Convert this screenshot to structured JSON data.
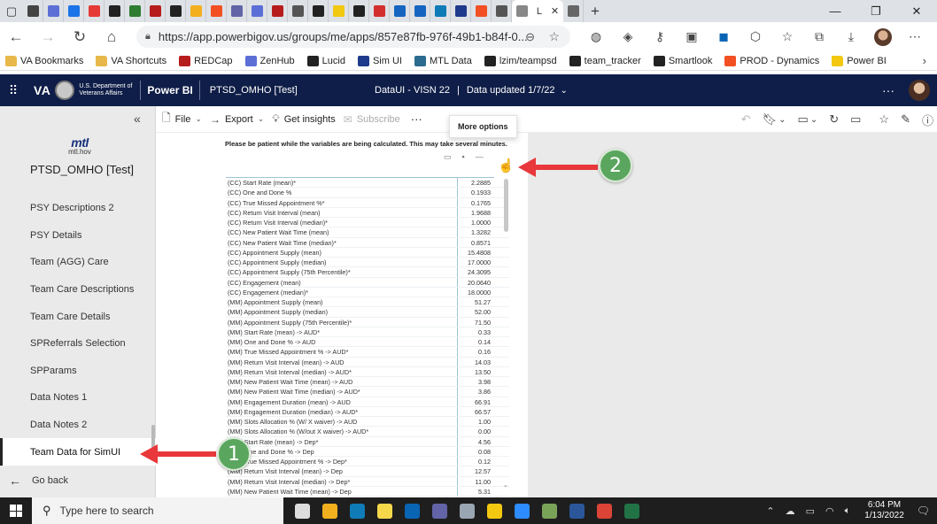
{
  "browser": {
    "tabs": [
      {
        "icon": "window-icon",
        "color": "#444444"
      },
      {
        "icon": "zenhub-icon",
        "color": "#5b6fd6"
      },
      {
        "icon": "bing-icon",
        "color": "#1a73e8"
      },
      {
        "icon": "asterisk-icon",
        "color": "#e53935"
      },
      {
        "icon": "github-icon",
        "color": "#222222"
      },
      {
        "icon": "sheet-icon",
        "color": "#2e7d32"
      },
      {
        "icon": "redcap-icon",
        "color": "#b71c1c"
      },
      {
        "icon": "github-icon",
        "color": "#222222"
      },
      {
        "icon": "doc-icon",
        "color": "#f2b01e"
      },
      {
        "icon": "grid-icon",
        "color": "#f25022"
      },
      {
        "icon": "teams-icon",
        "color": "#6264a7"
      },
      {
        "icon": "zenhub-icon",
        "color": "#5b6fd6"
      },
      {
        "icon": "redcap-icon",
        "color": "#b71c1c"
      },
      {
        "icon": "page-icon",
        "color": "#555555"
      },
      {
        "icon": "github-icon",
        "color": "#222222"
      },
      {
        "icon": "powerbi-icon",
        "color": "#f2c811"
      },
      {
        "icon": "github-icon",
        "color": "#222222"
      },
      {
        "icon": "github-error-icon",
        "color": "#d32f2f"
      },
      {
        "icon": "circle-icon",
        "color": "#1565c0"
      },
      {
        "icon": "circle-icon",
        "color": "#1565c0"
      },
      {
        "icon": "edge-icon",
        "color": "#0f7bb7"
      },
      {
        "icon": "mtl-icon",
        "color": "#1e3a8a"
      },
      {
        "icon": "ms-icon",
        "color": "#f25022"
      },
      {
        "icon": "page-icon",
        "color": "#555555"
      }
    ],
    "active_tab_label": "L",
    "new_tab": "+",
    "url": "https://app.powerbigov.us/groups/me/apps/857e87fb-976f-49b1-b84f-0...",
    "bookmarks": [
      {
        "label": "VA Bookmarks",
        "type": "folder",
        "color": "#e8b84a"
      },
      {
        "label": "VA Shortcuts",
        "type": "folder",
        "color": "#e8b84a"
      },
      {
        "label": "REDCap",
        "type": "icon",
        "color": "#b71c1c"
      },
      {
        "label": "ZenHub",
        "type": "icon",
        "color": "#5b6fd6"
      },
      {
        "label": "Lucid",
        "type": "icon",
        "color": "#222222"
      },
      {
        "label": "Sim UI",
        "type": "icon",
        "color": "#1e3a8a"
      },
      {
        "label": "MTL Data",
        "type": "icon",
        "color": "#2a6b8f"
      },
      {
        "label": "lzim/teampsd",
        "type": "icon",
        "color": "#222222"
      },
      {
        "label": "team_tracker",
        "type": "icon",
        "color": "#222222"
      },
      {
        "label": "Smartlook",
        "type": "icon",
        "color": "#222222"
      },
      {
        "label": "PROD - Dynamics",
        "type": "icon",
        "color": "#f25022"
      },
      {
        "label": "Power BI",
        "type": "folder",
        "color": "#f2c811"
      }
    ]
  },
  "pbi": {
    "org": "VA",
    "dept": "U.S. Department of Veterans Affairs",
    "brand": "Power BI",
    "report": "PTSD_OMHO [Test]",
    "workspace": "DataUI - VISN 22",
    "updated": "Data updated 1/7/22",
    "more": "···"
  },
  "nav": {
    "logo_big": "mtl",
    "logo_small": "mtl.hov",
    "title": "PTSD_OMHO [Test]",
    "items": [
      "PSY Descriptions 2",
      "PSY Details",
      "Team (AGG) Care",
      "Team Care Descriptions",
      "Team Care Details",
      "SPReferrals Selection",
      "SPParams",
      "Data Notes 1",
      "Data Notes 2",
      "Team Data for SimUI"
    ],
    "selected_index": 9,
    "go_back": "Go back"
  },
  "report_toolbar": {
    "file": "File",
    "export": "Export",
    "insights": "Get insights",
    "subscribe": "Subscribe",
    "more": "···",
    "tooltip": "More options"
  },
  "canvas": {
    "notice": "Please be patient while the variables are being calculated.  This may take several minutes.",
    "rows": [
      [
        "(CC) Start Rate (mean)*",
        "2.2885"
      ],
      [
        "(CC) One and Done %",
        "0.1933"
      ],
      [
        "(CC) True Missed Appointment %*",
        "0.1765"
      ],
      [
        "(CC) Return Visit Interval (mean)",
        "1.9688"
      ],
      [
        "(CC) Return Visit Interval (median)*",
        "1.0000"
      ],
      [
        "(CC) New Patient Wait Time (mean)",
        "1.3282"
      ],
      [
        "(CC) New Patient Wait Time (median)*",
        "0.8571"
      ],
      [
        "(CC) Appointment Supply (mean)",
        "15.4808"
      ],
      [
        "(CC) Appointment Supply (median)",
        "17.0000"
      ],
      [
        "(CC) Appointment Supply (75th Percentile)*",
        "24.3095"
      ],
      [
        "(CC) Engagement (mean)",
        "20.0640"
      ],
      [
        "(CC) Engagement (median)*",
        "18.0000"
      ],
      [
        "(MM) Appointment Supply (mean)",
        "51.27"
      ],
      [
        "(MM) Appointment Supply (median)",
        "52.00"
      ],
      [
        "(MM) Appointment Supply (75th Percentile)*",
        "71.50"
      ],
      [
        "(MM) Start Rate (mean) -> AUD*",
        "0.33"
      ],
      [
        "(MM) One and Done % -> AUD",
        "0.14"
      ],
      [
        "(MM) True Missed Appointment % -> AUD*",
        "0.16"
      ],
      [
        "(MM) Return Visit Interval (mean) -> AUD",
        "14.03"
      ],
      [
        "(MM) Return Visit Interval (median) -> AUD*",
        "13.50"
      ],
      [
        "(MM) New Patient Wait Time (mean) -> AUD",
        "3.98"
      ],
      [
        "(MM) New Patient Wait Time (median) -> AUD*",
        "3.86"
      ],
      [
        "(MM) Engagement Duration (mean) -> AUD",
        "66.91"
      ],
      [
        "(MM) Engagement Duration (median) -> AUD*",
        "66.57"
      ],
      [
        "(MM) Slots Allocation % (W/ X waiver) -> AUD",
        "1.00"
      ],
      [
        "(MM) Slots Allocation % (W/out X waiver) -> AUD*",
        "0.00"
      ],
      [
        "(MM) Start Rate (mean) -> Dep*",
        "4.56"
      ],
      [
        "(MM) One and Done % -> Dep",
        "0.08"
      ],
      [
        "(MM) True Missed Appointment % -> Dep*",
        "0.12"
      ],
      [
        "(MM) Return Visit Interval (mean) -> Dep",
        "12.57"
      ],
      [
        "(MM) Return Visit Interval (median) -> Dep*",
        "11.00"
      ],
      [
        "(MM) New Patient Wait Time (mean) -> Dep",
        "5.31"
      ]
    ]
  },
  "annotations": {
    "badge1": "1",
    "badge2": "2",
    "color": "#e8383b",
    "badge_color": "#5aa65e"
  },
  "taskbar": {
    "search_placeholder": "Type here to search",
    "time": "6:04 PM",
    "date": "1/13/2022",
    "apps": [
      {
        "icon": "task-view-icon",
        "color": "#dddddd"
      },
      {
        "icon": "file-explorer-icon",
        "color": "#f2b01e"
      },
      {
        "icon": "edge-icon",
        "color": "#0f7bb7"
      },
      {
        "icon": "sticky-notes-icon",
        "color": "#f7d84b"
      },
      {
        "icon": "outlook-icon",
        "color": "#0a64b4"
      },
      {
        "icon": "teams-icon",
        "color": "#6264a7"
      },
      {
        "icon": "app-icon",
        "color": "#9aa6b2"
      },
      {
        "icon": "powerbi-icon",
        "color": "#f2c811"
      },
      {
        "icon": "zoom-icon",
        "color": "#2d8cff"
      },
      {
        "icon": "app-icon",
        "color": "#7aa35a"
      },
      {
        "icon": "word-icon",
        "color": "#2b579a"
      },
      {
        "icon": "chrome-icon",
        "color": "#db4437"
      },
      {
        "icon": "excel-icon",
        "color": "#217346"
      }
    ]
  }
}
